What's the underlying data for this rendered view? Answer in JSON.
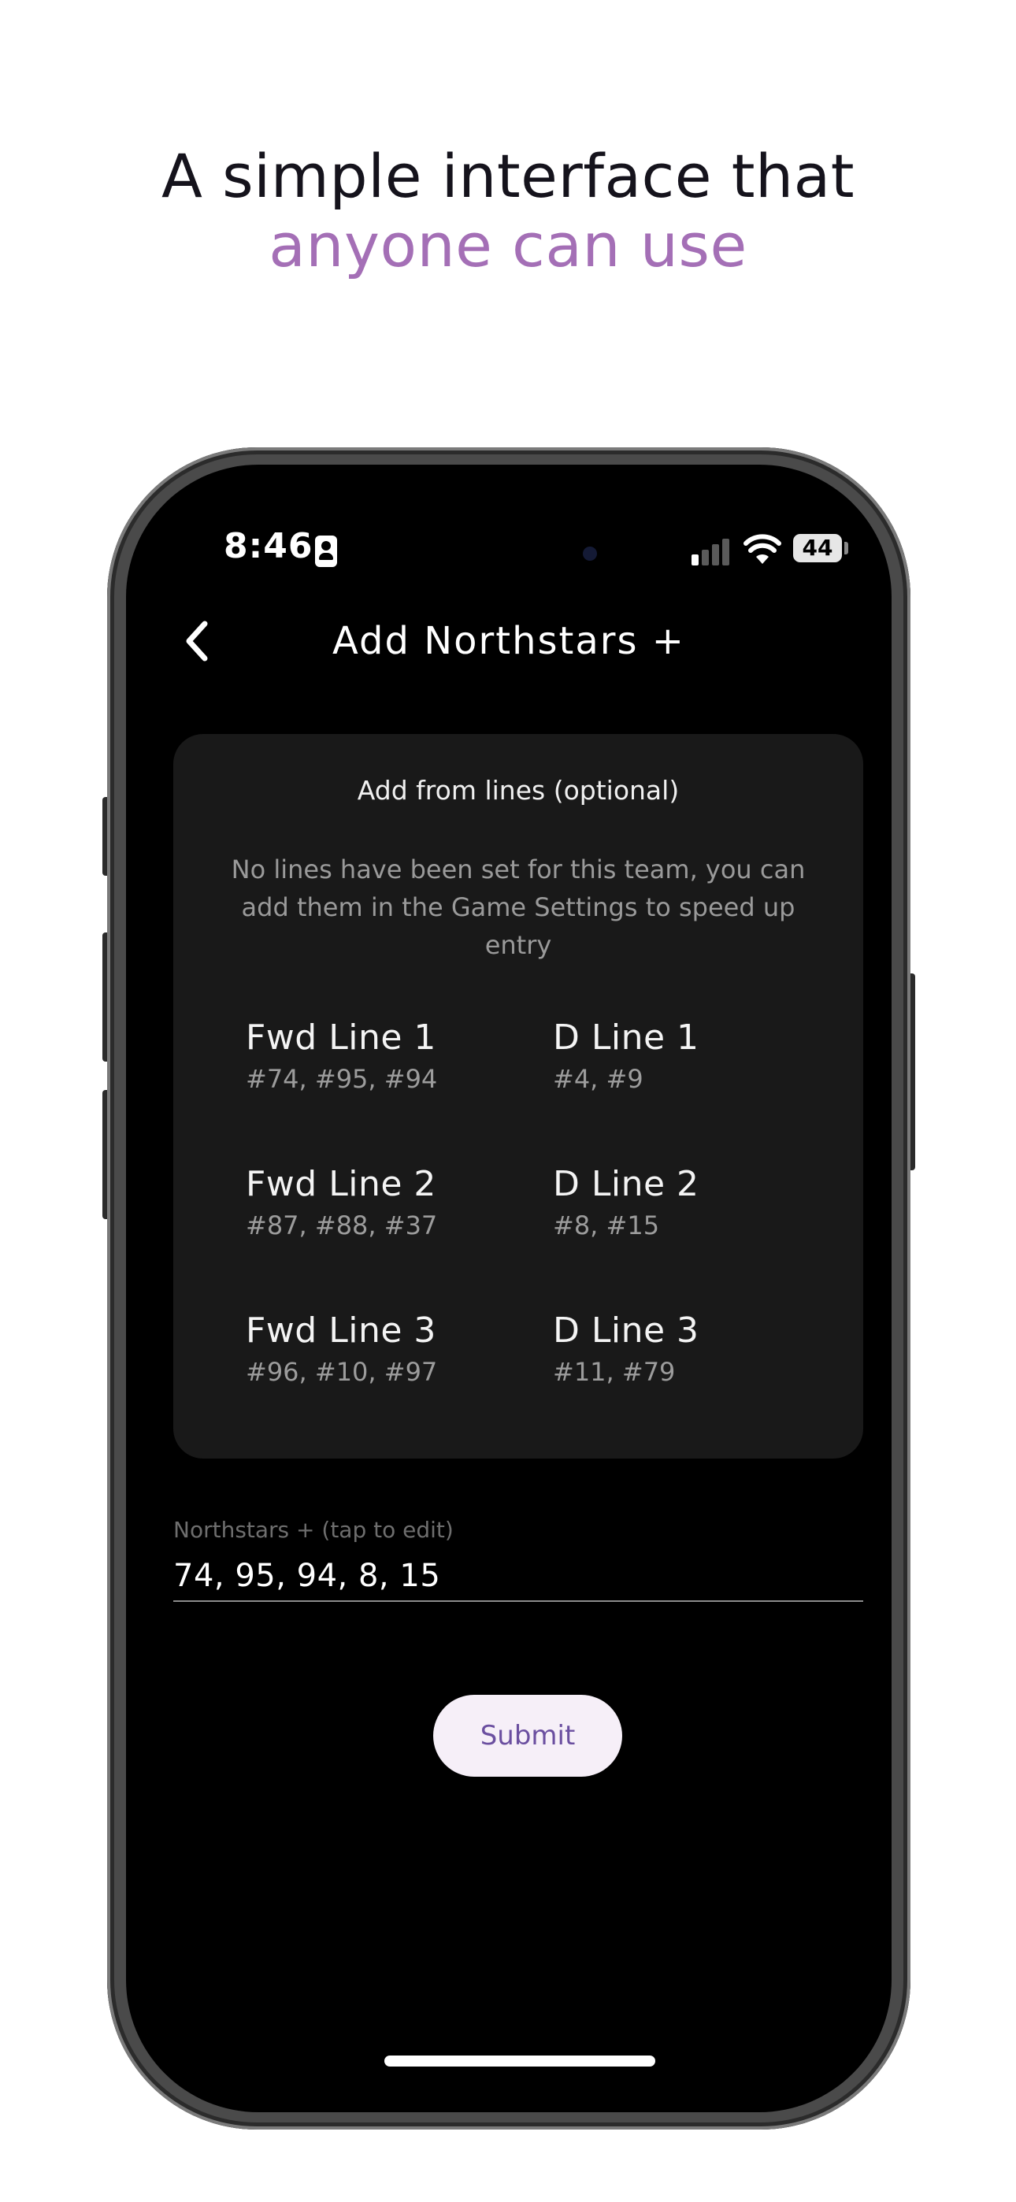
{
  "promo": {
    "headline_line1": "A simple interface that",
    "headline_line2": "anyone can use",
    "accent_color": "#a46fb6"
  },
  "status_bar": {
    "time": "8:46",
    "battery": "44",
    "icons": [
      "contact-card-icon",
      "signal-icon",
      "wifi-icon",
      "battery-icon"
    ]
  },
  "header": {
    "back_icon": "chevron-left-icon",
    "title": "Add Northstars +"
  },
  "lines_card": {
    "title": "Add from lines (optional)",
    "note": "No lines have been set for this team, you can add them in the Game Settings to speed up entry",
    "lines": [
      {
        "name": "Fwd Line 1",
        "players": "#74, #95, #94"
      },
      {
        "name": "D Line 1",
        "players": "#4, #9"
      },
      {
        "name": "Fwd Line 2",
        "players": "#87, #88, #37"
      },
      {
        "name": "D Line 2",
        "players": "#8, #15"
      },
      {
        "name": "Fwd Line 3",
        "players": "#96, #10, #97"
      },
      {
        "name": "D Line 3",
        "players": "#11, #79"
      }
    ]
  },
  "northstars_field": {
    "label": "Northstars + (tap to edit)",
    "value": "74, 95, 94, 8, 15"
  },
  "submit_button": {
    "label": "Submit",
    "text_color": "#6b4fa0",
    "background": "#f6eff8"
  }
}
